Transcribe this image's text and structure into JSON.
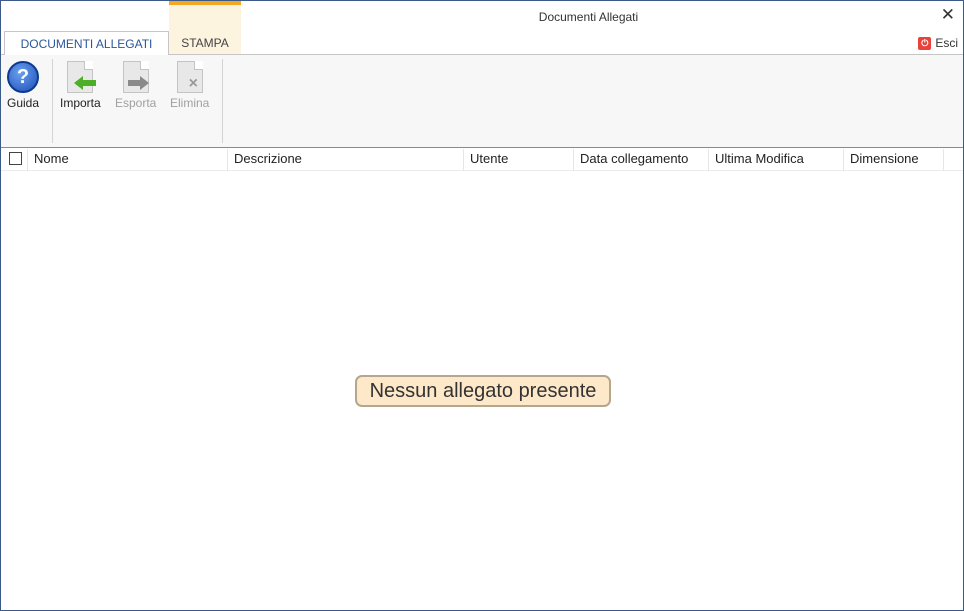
{
  "window": {
    "title": "Documenti Allegati",
    "close_glyph": "✕"
  },
  "tabs": [
    {
      "label": "DOCUMENTI ALLEGATI",
      "active": true
    },
    {
      "label": "STAMPA",
      "active": false
    }
  ],
  "esci": {
    "label": "Esci",
    "icon": "power-icon"
  },
  "ribbon": {
    "buttons": [
      {
        "label": "Guida",
        "icon": "help-icon",
        "enabled": true
      },
      {
        "label": "Importa",
        "icon": "import-icon",
        "enabled": true
      },
      {
        "label": "Esporta",
        "icon": "export-icon",
        "enabled": false
      },
      {
        "label": "Elimina",
        "icon": "delete-icon",
        "enabled": false
      }
    ]
  },
  "grid": {
    "columns": [
      "Nome",
      "Descrizione",
      "Utente",
      "Data collegamento",
      "Ultima Modifica",
      "Dimensione"
    ],
    "rows": [],
    "empty_message": "Nessun allegato presente"
  },
  "colors": {
    "accent": "#2b579a",
    "stampa_tab": "#f5a623",
    "empty_bg": "#fde8c9"
  }
}
